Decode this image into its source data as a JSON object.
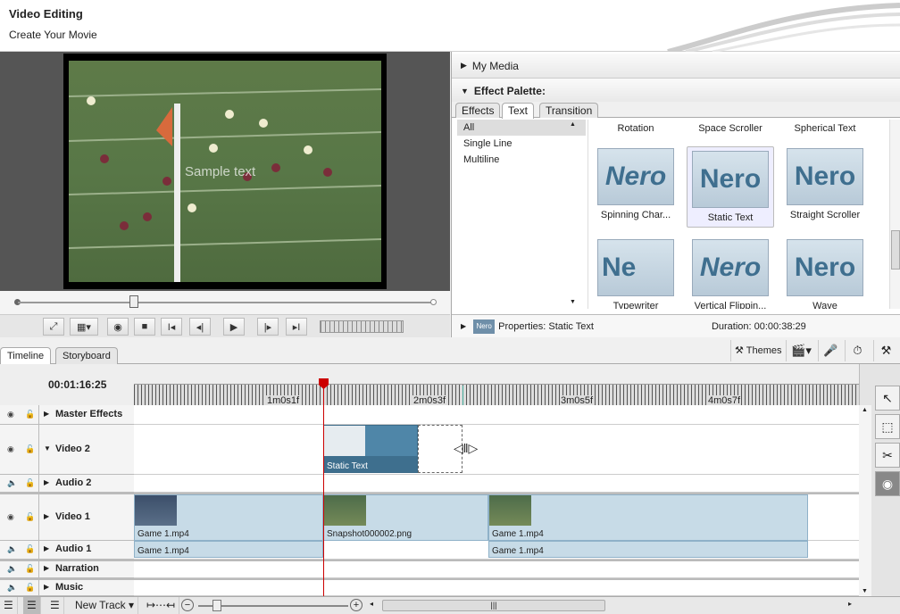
{
  "header": {
    "title": "Video Editing",
    "subtitle": "Create Your Movie"
  },
  "preview": {
    "overlay_text": "Sample text"
  },
  "right_panel": {
    "my_media_label": "My Media",
    "effect_palette_label": "Effect Palette:",
    "tabs": [
      "Effects",
      "Text",
      "Transition"
    ],
    "active_tab": "Text",
    "categories": [
      "All",
      "Single Line",
      "Multiline"
    ],
    "top_row": [
      "Rotation",
      "Space Scroller",
      "Spherical Text"
    ],
    "row2": [
      "Spinning Char...",
      "Static Text",
      "Straight Scroller"
    ],
    "row3": [
      "Typewriter",
      "Vertical Flippin...",
      "Wave"
    ],
    "thumb_text": {
      "spinning": "Nero",
      "static": "Nero",
      "straight": "Nero",
      "typewriter": "Ne",
      "vertical": "Nero",
      "wave": "Nero"
    },
    "properties_logo": "Nero",
    "properties_label": "Properties: Static Text",
    "duration_label": "Duration: 00:00:38:29"
  },
  "timeline": {
    "tabs": [
      "Timeline",
      "Storyboard"
    ],
    "themes_label": "Themes",
    "timecode": "00:01:16:25",
    "ruler_labels": [
      "1m0s1f",
      "2m0s3f",
      "3m0s5f",
      "4m0s7f"
    ],
    "tracks": [
      {
        "name": "Master Effects"
      },
      {
        "name": "Video 2"
      },
      {
        "name": "Audio 2"
      },
      {
        "name": "Video 1"
      },
      {
        "name": "Audio 1"
      },
      {
        "name": "Narration"
      },
      {
        "name": "Music"
      }
    ],
    "clips": {
      "static_text": "Static Text",
      "v1_clip1": "Game 1.mp4",
      "v1_clip2": "Snapshot000002.png",
      "v1_clip3": "Game 1.mp4",
      "a1_clip1": "Game 1.mp4",
      "a1_clip2": "Game 1.mp4"
    }
  },
  "bottombar": {
    "new_track_label": "New Track"
  }
}
